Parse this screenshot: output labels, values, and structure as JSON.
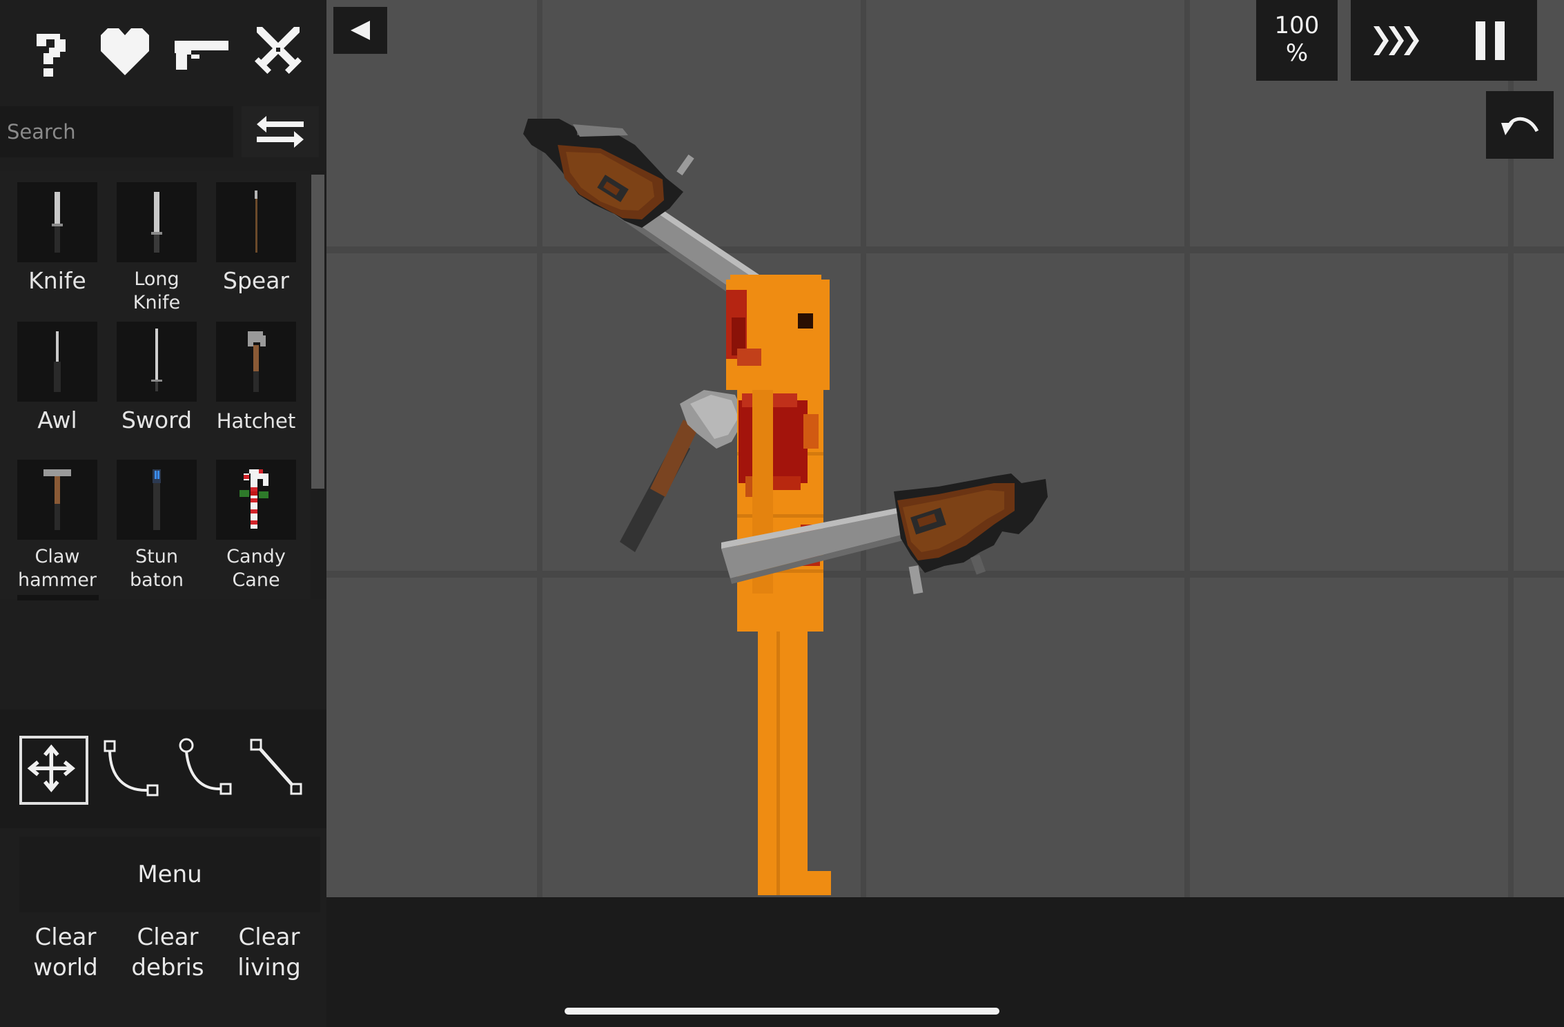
{
  "categories": [
    {
      "name": "help",
      "icon": "question-mark-icon"
    },
    {
      "name": "life",
      "icon": "heart-icon"
    },
    {
      "name": "firearms",
      "icon": "pistol-icon"
    },
    {
      "name": "melee",
      "icon": "crossed-swords-icon"
    }
  ],
  "search": {
    "placeholder": "Search",
    "value": ""
  },
  "items": [
    {
      "label": "Knife"
    },
    {
      "label": "Long Knife",
      "line1": "Long",
      "line2": "Knife"
    },
    {
      "label": "Spear"
    },
    {
      "label": "Awl"
    },
    {
      "label": "Sword"
    },
    {
      "label": "Hatchet"
    },
    {
      "label": "Claw hammer",
      "line1": "Claw",
      "line2": "hammer"
    },
    {
      "label": "Stun baton",
      "line1": "Stun",
      "line2": "baton"
    },
    {
      "label": "Candy Cane",
      "line1": "Candy",
      "line2": "Cane"
    }
  ],
  "tools": [
    {
      "name": "drag",
      "icon": "move-arrows-icon",
      "selected": true
    },
    {
      "name": "rope",
      "icon": "rope-icon"
    },
    {
      "name": "spring",
      "icon": "spring-icon"
    },
    {
      "name": "rod",
      "icon": "rod-icon"
    }
  ],
  "menu": {
    "label": "Menu"
  },
  "clear_buttons": {
    "world": {
      "line1": "Clear",
      "line2": "world"
    },
    "debris": {
      "line1": "Clear",
      "line2": "debris"
    },
    "living": {
      "line1": "Clear",
      "line2": "living"
    }
  },
  "hud": {
    "speed_value": "100",
    "speed_unit": "%"
  },
  "colors": {
    "panel": "#1e1e1e",
    "world_bg": "#505050",
    "human_orange": "#ef8c12",
    "blood": "#a3140c"
  }
}
